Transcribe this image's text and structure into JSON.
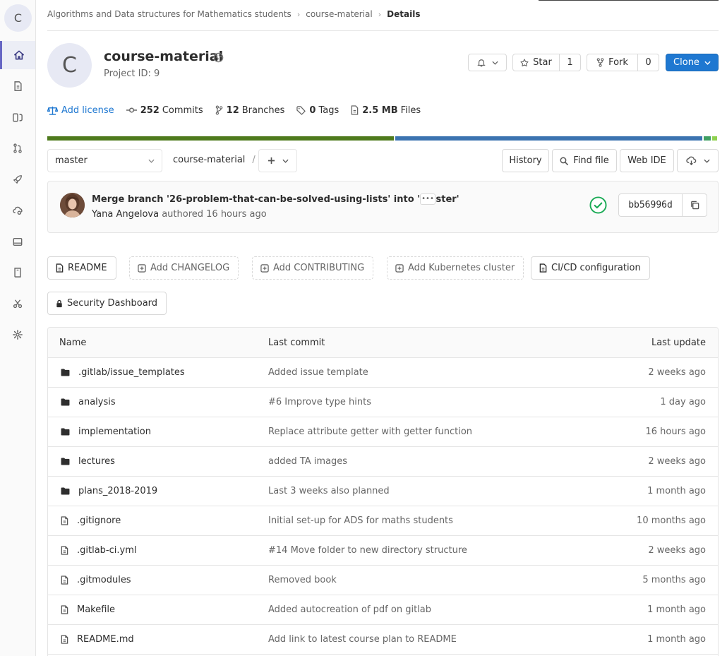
{
  "breadcrumb": {
    "group": "Algorithms and Data structures for Mathematics students",
    "project": "course-material",
    "current": "Details"
  },
  "sidebar": {
    "avatar_letter": "C",
    "items": [
      {
        "name": "project-overview",
        "icon": "home-icon",
        "active": true
      },
      {
        "name": "repository",
        "icon": "doc-icon",
        "active": false
      },
      {
        "name": "issues",
        "icon": "issues-icon",
        "active": false
      },
      {
        "name": "merge-requests",
        "icon": "merge-request-icon",
        "active": false
      },
      {
        "name": "ci-cd",
        "icon": "rocket-icon",
        "active": false
      },
      {
        "name": "operations",
        "icon": "cloud-gear-icon",
        "active": false
      },
      {
        "name": "packages",
        "icon": "package-icon",
        "active": false
      },
      {
        "name": "wiki",
        "icon": "book-icon",
        "active": false
      },
      {
        "name": "snippets",
        "icon": "scissors-icon",
        "active": false
      },
      {
        "name": "settings",
        "icon": "gear-icon",
        "active": false
      }
    ]
  },
  "project": {
    "avatar_letter": "C",
    "name": "course-material",
    "id_text": "Project ID: 9"
  },
  "actions": {
    "star_label": "Star",
    "star_count": "1",
    "fork_label": "Fork",
    "fork_count": "0",
    "clone_label": "Clone"
  },
  "stats": {
    "license": "Add license",
    "commits_count": "252",
    "commits_label": "Commits",
    "branches_count": "12",
    "branches_label": "Branches",
    "tags_count": "0",
    "tags_label": "Tags",
    "files_size": "2.5 MB",
    "files_label": "Files"
  },
  "languages": [
    {
      "share": 51.8,
      "color": "#4e7a1c"
    },
    {
      "share": 45.8,
      "color": "#3b73b0"
    },
    {
      "share": 1.1,
      "color": "#3f9f62"
    },
    {
      "share": 0.7,
      "color": "#8fd14f"
    }
  ],
  "toolbar": {
    "branch": "master",
    "path_root": "course-material",
    "path_sep": "/",
    "history": "History",
    "find_file": "Find file",
    "web_ide": "Web IDE"
  },
  "commit": {
    "title": "Merge branch '26-problem-that-can-be-solved-using-lists' into 'master'",
    "author": "Yana Angelova",
    "authored": "authored 16 hours ago",
    "sha": "bb56996d",
    "pipeline_status": "passed"
  },
  "quick_buttons": {
    "readme": "README",
    "changelog": "Add CHANGELOG",
    "contributing": "Add CONTRIBUTING",
    "kubernetes": "Add Kubernetes cluster",
    "cicd": "CI/CD configuration",
    "security": "Security Dashboard"
  },
  "file_table": {
    "headers": {
      "name": "Name",
      "last_commit": "Last commit",
      "last_update": "Last update"
    },
    "rows": [
      {
        "type": "folder",
        "name": ".gitlab/issue_templates",
        "commit": "Added issue template",
        "updated": "2 weeks ago"
      },
      {
        "type": "folder",
        "name": "analysis",
        "commit": "#6 Improve type hints",
        "updated": "1 day ago"
      },
      {
        "type": "folder",
        "name": "implementation",
        "commit": "Replace attribute getter with getter function",
        "updated": "16 hours ago"
      },
      {
        "type": "folder",
        "name": "lectures",
        "commit": "added TA images",
        "updated": "2 weeks ago"
      },
      {
        "type": "folder",
        "name": "plans_2018-2019",
        "commit": "Last 3 weeks also planned",
        "updated": "1 month ago"
      },
      {
        "type": "file",
        "name": ".gitignore",
        "commit": "Initial set-up for ADS for maths students",
        "updated": "10 months ago"
      },
      {
        "type": "file",
        "name": ".gitlab-ci.yml",
        "commit": "#14 Move folder to new directory structure",
        "updated": "2 weeks ago"
      },
      {
        "type": "file",
        "name": ".gitmodules",
        "commit": "Removed book",
        "updated": "5 months ago"
      },
      {
        "type": "file",
        "name": "Makefile",
        "commit": "Added autocreation of pdf on gitlab",
        "updated": "1 month ago"
      },
      {
        "type": "file",
        "name": "README.md",
        "commit": "Add link to latest course plan to README",
        "updated": "1 month ago"
      }
    ]
  }
}
